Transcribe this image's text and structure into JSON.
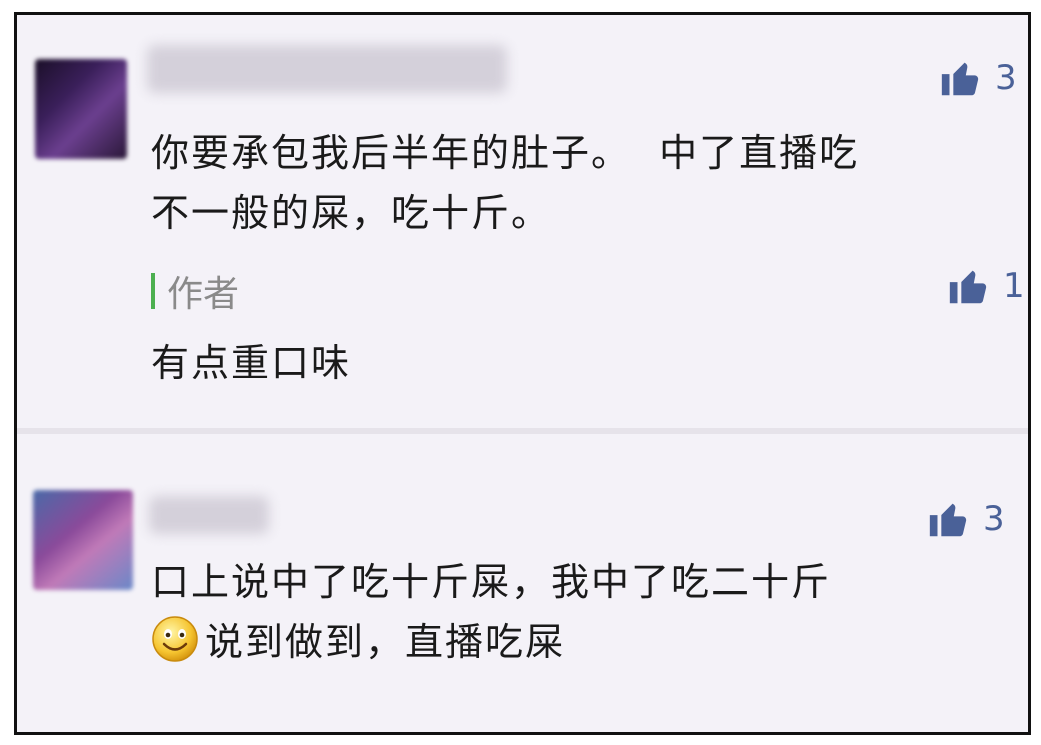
{
  "comment1": {
    "likes": "3",
    "text_line1": "你要承包我后半年的肚子。  中了直播吃",
    "text_line2": "不一般的屎，吃十斤。",
    "reply": {
      "author_label": "作者",
      "likes": "1",
      "text": "有点重口味"
    }
  },
  "comment2": {
    "likes": "3",
    "text_line1": "口上说中了吃十斤屎，我中了吃二十斤",
    "text_line2": "说到做到，直播吃屎"
  },
  "icons": {
    "like": "thumbs-up-icon",
    "emoji": "smiley-emoji-icon"
  },
  "colors": {
    "like": "#4a6198",
    "author_bar": "#4caf50",
    "background": "#f4f2f8"
  }
}
